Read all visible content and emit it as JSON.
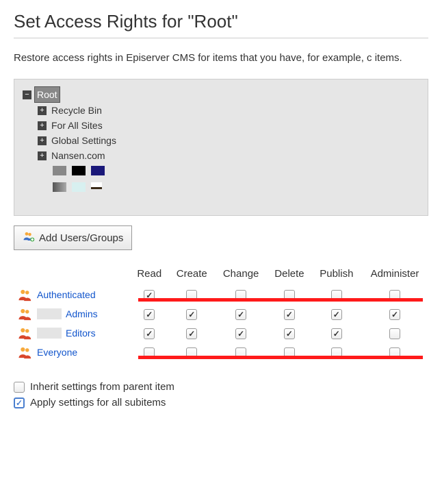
{
  "header": {
    "title": "Set Access Rights for \"Root\""
  },
  "description": "Restore access rights in Episerver CMS for items that you have, for example, c items.",
  "tree": {
    "root": "Root",
    "children": [
      "Recycle Bin",
      "For All Sites",
      "Global Settings",
      "Nansen.com"
    ]
  },
  "buttons": {
    "add_users_groups": "Add Users/Groups"
  },
  "permissions": {
    "columns": [
      "Read",
      "Create",
      "Change",
      "Delete",
      "Publish",
      "Administer"
    ],
    "rows": [
      {
        "name": "Authenticated",
        "redacted": false,
        "checks": [
          true,
          false,
          false,
          false,
          false,
          false
        ],
        "highlight": true
      },
      {
        "name": "Admins",
        "redacted": true,
        "checks": [
          true,
          true,
          true,
          true,
          true,
          true
        ],
        "highlight": false
      },
      {
        "name": "Editors",
        "redacted": true,
        "checks": [
          true,
          true,
          true,
          true,
          true,
          false
        ],
        "highlight": false
      },
      {
        "name": "Everyone",
        "redacted": false,
        "checks": [
          false,
          false,
          false,
          false,
          false,
          false
        ],
        "highlight": true
      }
    ]
  },
  "options": {
    "inherit_label": "Inherit settings from parent item",
    "inherit_checked": false,
    "apply_label": "Apply settings for all subitems",
    "apply_checked": true
  }
}
